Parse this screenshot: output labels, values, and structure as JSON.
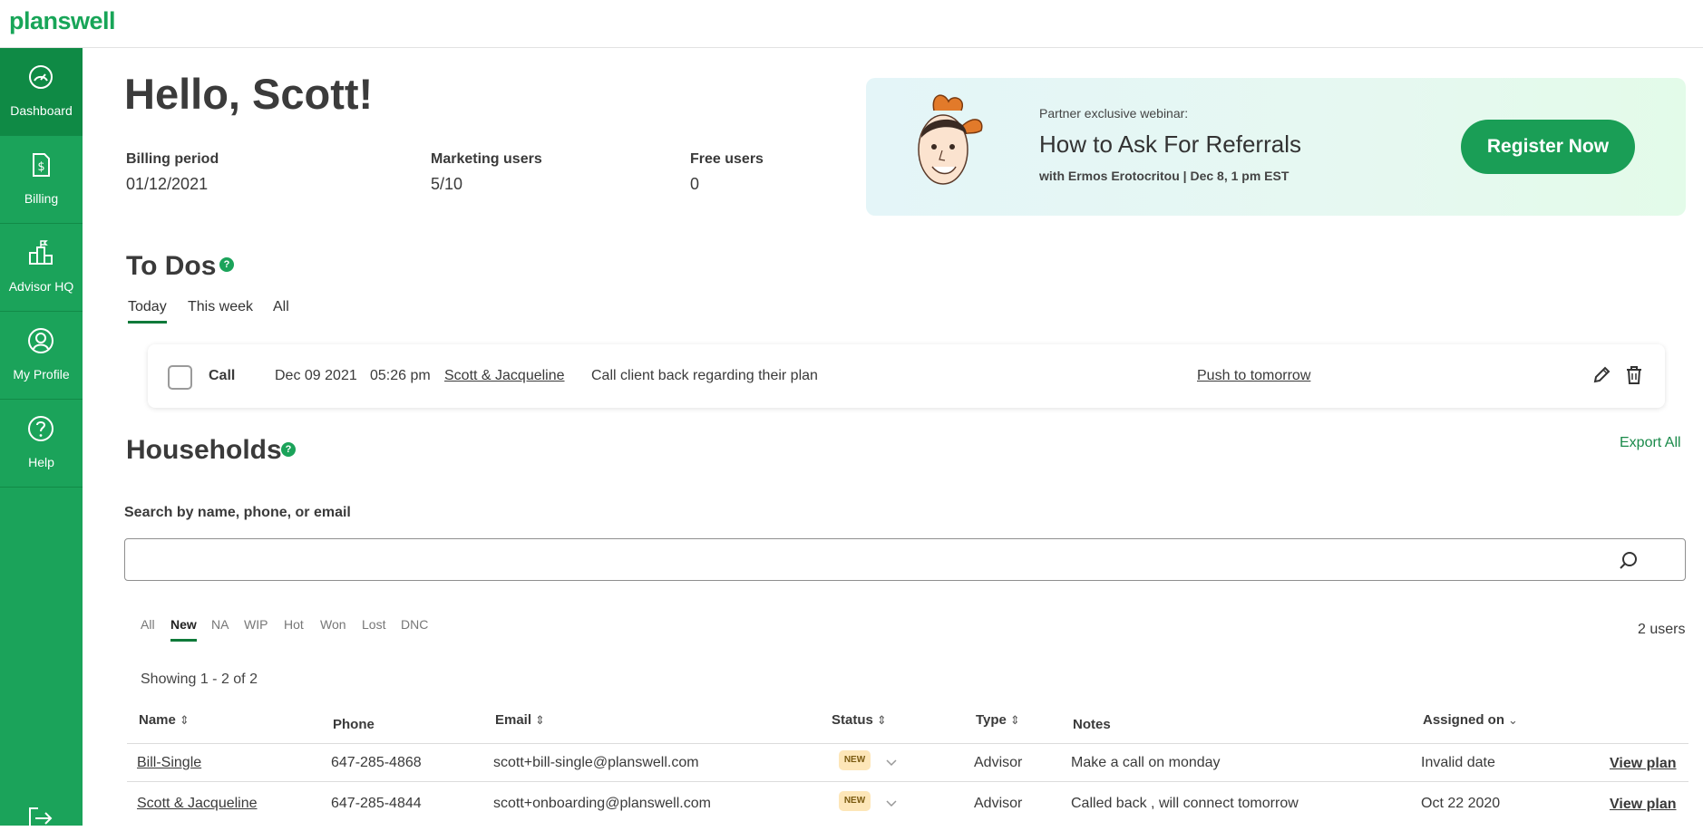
{
  "app": {
    "logo": "planswell"
  },
  "sidebar": {
    "items": [
      {
        "label": "Dashboard",
        "icon": "dashboard-gauge-icon",
        "active": true
      },
      {
        "label": "Billing",
        "icon": "billing-dollar-icon"
      },
      {
        "label": "Advisor HQ",
        "icon": "advisor-hq-icon"
      },
      {
        "label": "My Profile",
        "icon": "profile-icon"
      },
      {
        "label": "Help",
        "icon": "help-icon"
      }
    ],
    "logout_icon": "logout-icon"
  },
  "greeting": "Hello, Scott!",
  "stats": {
    "billing_label": "Billing period",
    "billing_value": "01/12/2021",
    "marketing_label": "Marketing users",
    "marketing_value": "5/10",
    "free_label": "Free users",
    "free_value": "0"
  },
  "banner": {
    "pre": "Partner exclusive webinar:",
    "title": "How to Ask For Referrals",
    "sub": "with Ermos Erotocritou | Dec 8, 1 pm EST",
    "button": "Register Now"
  },
  "todos": {
    "title": "To Dos",
    "help_mark": "?",
    "tabs": [
      "Today",
      "This week",
      "All"
    ],
    "active_tab": "Today",
    "item": {
      "type": "Call",
      "date": "Dec 09 2021",
      "time": "05:26 pm",
      "client": "Scott & Jacqueline",
      "note": "Call client back regarding their plan",
      "action": "Push to tomorrow"
    }
  },
  "households": {
    "title": "Households",
    "help_mark": "?",
    "export": "Export All",
    "search_label": "Search by name, phone, or email",
    "search_value": "",
    "filters": [
      "All",
      "New",
      "NA",
      "WIP",
      "Hot",
      "Won",
      "Lost",
      "DNC"
    ],
    "active_filter": "New",
    "users_count": "2 users",
    "showing": "Showing 1 - 2 of 2",
    "columns": {
      "name": "Name",
      "phone": "Phone",
      "email": "Email",
      "status": "Status",
      "type": "Type",
      "notes": "Notes",
      "assigned": "Assigned on"
    },
    "rows": [
      {
        "name": "Bill-Single",
        "phone": "647-285-4868",
        "email": "scott+bill-single@planswell.com",
        "status": "NEW",
        "type": "Advisor",
        "notes": "Make a call on monday",
        "assigned": "Invalid date",
        "action": "View plan"
      },
      {
        "name": "Scott & Jacqueline",
        "phone": "647-285-4844",
        "email": "scott+onboarding@planswell.com",
        "status": "NEW",
        "type": "Advisor",
        "notes": "Called back , will connect tomorrow",
        "assigned": "Oct 22 2020",
        "action": "View plan"
      }
    ]
  },
  "colors": {
    "brand": "#1ba35a",
    "brand_dark": "#0f8a45",
    "link": "#1a7a43",
    "badge_bg": "#fde6b8"
  }
}
